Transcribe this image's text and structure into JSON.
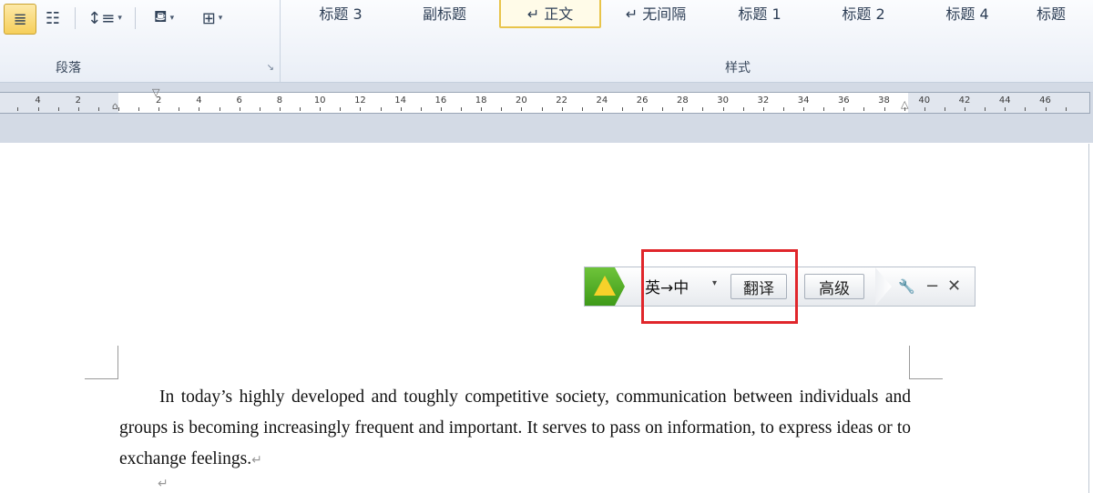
{
  "ribbon": {
    "paragraph_group": {
      "label": "段落",
      "launcher_glyph": "↘",
      "tools": [
        {
          "name": "justify-icon",
          "glyph": "≣"
        },
        {
          "name": "distributed-icon",
          "glyph": "☷"
        },
        {
          "name": "line-spacing-icon",
          "glyph": "↕≡"
        },
        {
          "name": "shading-icon",
          "glyph": "⛾"
        },
        {
          "name": "borders-icon",
          "glyph": "⊞"
        }
      ],
      "dropdown_glyph": "▾"
    },
    "styles_group": {
      "label": "样式",
      "items": [
        "标题 3",
        "副标题",
        "↵ 正文",
        "↵ 无间隔",
        "标题 1",
        "标题 2",
        "标题 4",
        "标题"
      ],
      "selected": "↵ 正文"
    }
  },
  "ruler": {
    "ticks": [
      "4",
      "2",
      "2",
      "4",
      "6",
      "8",
      "10",
      "12",
      "14",
      "16",
      "18",
      "20",
      "22",
      "24",
      "26",
      "28",
      "30",
      "32",
      "34",
      "36",
      "38",
      "40",
      "42",
      "44",
      "46"
    ],
    "left_indent_glyph": "⌂",
    "first_line_indent_glyph": "▽",
    "right_indent_glyph": "△"
  },
  "document": {
    "paragraph": "In today’s highly developed and toughly competitive society, communication between individuals and groups is becoming increasingly frequent and important. It serves to pass on information, to express ideas or to exchange feelings.",
    "paragraph_mark": "↵",
    "empty_paragraph_mark": "↵"
  },
  "translate_toolbar": {
    "language_pair": "英→中",
    "dropdown_glyph": "▾",
    "translate_label": "翻译",
    "advanced_label": "高级",
    "settings_glyph": "🔧",
    "minimize_glyph": "−",
    "close_glyph": "✕"
  },
  "colors": {
    "highlight": "#e0262b",
    "logo_green": "#4fae22",
    "logo_yellow": "#f6d12a",
    "active_tool": "#f6cf5a"
  }
}
